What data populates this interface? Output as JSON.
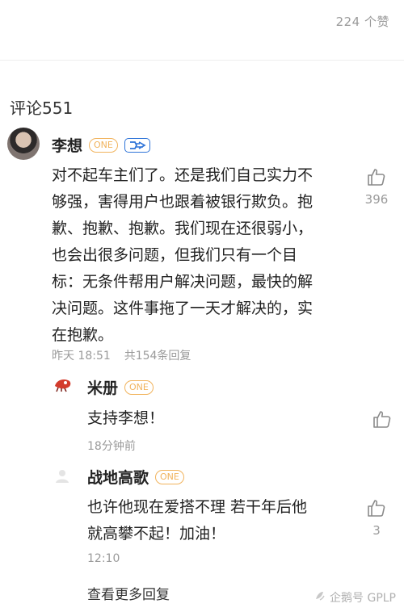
{
  "header": {
    "likes_count": "224 个赞"
  },
  "comments_section": {
    "title": "评论551",
    "main_comment": {
      "username": "李想",
      "badge": "ONE",
      "text_lines": [
        "对不起车主们了。还是我们自己实力不",
        "够强，害得用户也跟着被银行欺负。抱",
        "歉、抱歉、抱歉。我们现在还很弱小，",
        "也会出很多问题，但我们只有一个目",
        "标：无条件帮用户解决问题，最快的解",
        "决问题。这件事拖了一天才解决的，实",
        "在抱歉。"
      ],
      "time": "昨天 18:51",
      "reply_count": "共154条回复",
      "likes": "396"
    },
    "replies": [
      {
        "username": "米册",
        "badge": "ONE",
        "text_lines": [
          "支持李想！"
        ],
        "time": "18分钟前",
        "likes": ""
      },
      {
        "username": "战地高歌",
        "badge": "ONE",
        "text_lines": [
          "也许他现在爱搭不理 若干年后他",
          "就高攀不起！加油！"
        ],
        "time": "12:10",
        "likes": "3"
      }
    ],
    "more_replies_label": "查看更多回复"
  },
  "watermark": "企鹅号 GPLP",
  "colors": {
    "badge_orange": "#f1b35c",
    "badge_blue": "#2f74d8",
    "meta_gray": "#9a9a9a"
  },
  "icons": [
    "thumbs-up-icon",
    "verified-badge-icon",
    "penguin-icon"
  ]
}
